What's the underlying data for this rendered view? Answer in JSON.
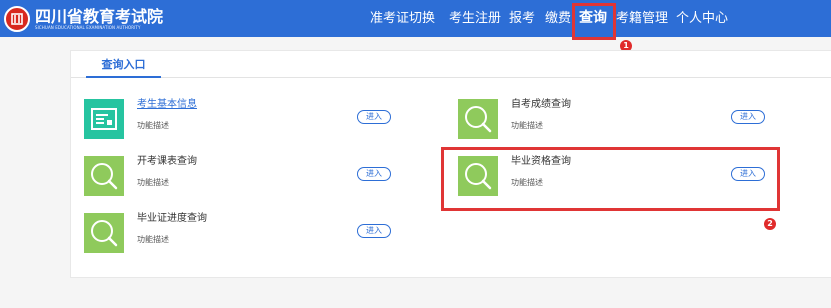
{
  "header": {
    "logo_cn": "四川省教育考试院",
    "logo_en": "SICHUAN EDUCATIONAL EXAMINATION AUTHORITY",
    "nav": [
      {
        "label": "准考证切换"
      },
      {
        "label": "考生注册"
      },
      {
        "label": "报考"
      },
      {
        "label": "缴费"
      },
      {
        "label": "查询",
        "active": true
      },
      {
        "label": "考籍管理"
      },
      {
        "label": "个人中心"
      }
    ]
  },
  "tab": {
    "label": "查询入口"
  },
  "entries": [
    {
      "title": "考生基本信息",
      "desc": "功能描述",
      "button": "进入",
      "icon": "id-card-icon"
    },
    {
      "title": "自考成绩查询",
      "desc": "功能描述",
      "button": "进入",
      "icon": "search-icon"
    },
    {
      "title": "开考课表查询",
      "desc": "功能描述",
      "button": "进入",
      "icon": "search-icon"
    },
    {
      "title": "毕业资格查询",
      "desc": "功能描述",
      "button": "进入",
      "icon": "search-icon"
    },
    {
      "title": "毕业证进度查询",
      "desc": "功能描述",
      "button": "进入",
      "icon": "search-icon"
    }
  ],
  "annotations": {
    "badge1": "1",
    "badge2": "2"
  },
  "colors": {
    "brand": "#2d6ed6",
    "icon_green": "#8fca5c",
    "icon_teal": "#26c4a0",
    "highlight": "#e03535"
  }
}
